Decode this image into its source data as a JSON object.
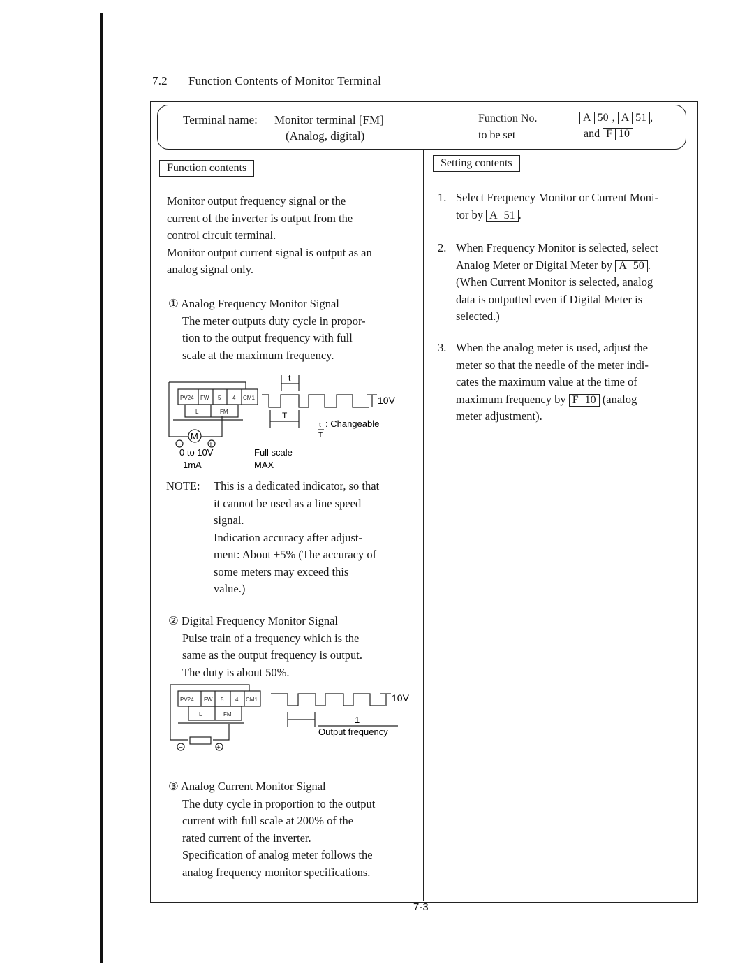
{
  "section": {
    "number": "7.2",
    "title": "Function Contents of Monitor Terminal"
  },
  "header": {
    "terminal_label": "Terminal name:",
    "terminal_name": "Monitor terminal [FM]",
    "terminal_sub": "(Analog, digital)",
    "function_no_line1": "Function No.",
    "function_no_line2": "to be set",
    "codes": [
      {
        "prefix": "A",
        "num": "50"
      },
      {
        "prefix": "A",
        "num": "51"
      },
      {
        "prefix": "F",
        "num": "10"
      }
    ],
    "sep_comma": ",",
    "and_word": "and"
  },
  "left": {
    "tag": "Function contents",
    "intro": [
      "Monitor output frequency signal or the",
      "current of the inverter is output from the",
      "control circuit terminal.",
      "Monitor output current signal is output as an",
      "analog signal only."
    ],
    "sig1": {
      "marker": "①",
      "title": "Analog Frequency Monitor Signal",
      "lines": [
        "The meter outputs duty cycle in propor-",
        "tion to the output frequency with full",
        "scale at the maximum frequency."
      ],
      "figure": {
        "terminals_top": [
          "PV24",
          "FW",
          "5",
          "4",
          "CM1"
        ],
        "terminals_bottom": [
          "L",
          "FM"
        ],
        "meter_symbol": "M",
        "minus": "−",
        "plus": "+",
        "t_label": "t",
        "T_label": "T",
        "voltage": "10V",
        "ratio_num": "t",
        "ratio_den": "T",
        "changeable": ": Changeable",
        "range_line1": "0 to 10V",
        "range_line2": "1mA",
        "fullscale_line1": "Full scale",
        "fullscale_line2": "MAX"
      }
    },
    "note": {
      "label": "NOTE:",
      "lines": [
        "This is a dedicated indicator, so that",
        "it cannot be used as a line speed",
        "signal.",
        "Indication accuracy after adjust-",
        "ment:  About ±5% (The accuracy of",
        "some meters may exceed this",
        "value.)"
      ]
    },
    "sig2": {
      "marker": "②",
      "title": "Digital Frequency Monitor Signal",
      "lines": [
        "Pulse train of a frequency which is the",
        "same as the output frequency is output.",
        "The duty is about 50%."
      ],
      "figure": {
        "terminals_top": [
          "PV24",
          "FW",
          "5",
          "4",
          "CM1"
        ],
        "terminals_bottom": [
          "L",
          "FM"
        ],
        "voltage": "10V",
        "frac_num": "1",
        "frac_den": "Output frequency",
        "minus": "−",
        "plus": "+"
      }
    },
    "sig3": {
      "marker": "③",
      "title": "Analog Current Monitor Signal",
      "lines": [
        "The duty cycle in proportion to the output",
        "current with full scale at 200% of the",
        "rated current of the inverter.",
        "Specification of analog meter follows the",
        "analog frequency monitor specifications."
      ]
    }
  },
  "right": {
    "tag": "Setting contents",
    "items": [
      {
        "n": "1.",
        "lines": [
          "Select Frequency Monitor or Current Moni-",
          "tor by"
        ],
        "code": {
          "prefix": "A",
          "num": "51"
        },
        "after": "."
      },
      {
        "n": "2.",
        "lines": [
          "When Frequency Monitor is selected, select",
          "Analog Meter or Digital Meter by"
        ],
        "code": {
          "prefix": "A",
          "num": "50"
        },
        "after": ".",
        "more": [
          "(When Current Monitor is selected, analog",
          "data is outputted even if Digital Meter is",
          "selected.)"
        ]
      },
      {
        "n": "3.",
        "lines": [
          "When the analog meter is used, adjust the",
          "meter so that the needle of the meter indi-",
          "cates the maximum value at the time of",
          "maximum frequency by"
        ],
        "code": {
          "prefix": "F",
          "num": "10"
        },
        "after": " (analog",
        "more": [
          "meter adjustment)."
        ]
      }
    ]
  },
  "page_number": "7-3"
}
